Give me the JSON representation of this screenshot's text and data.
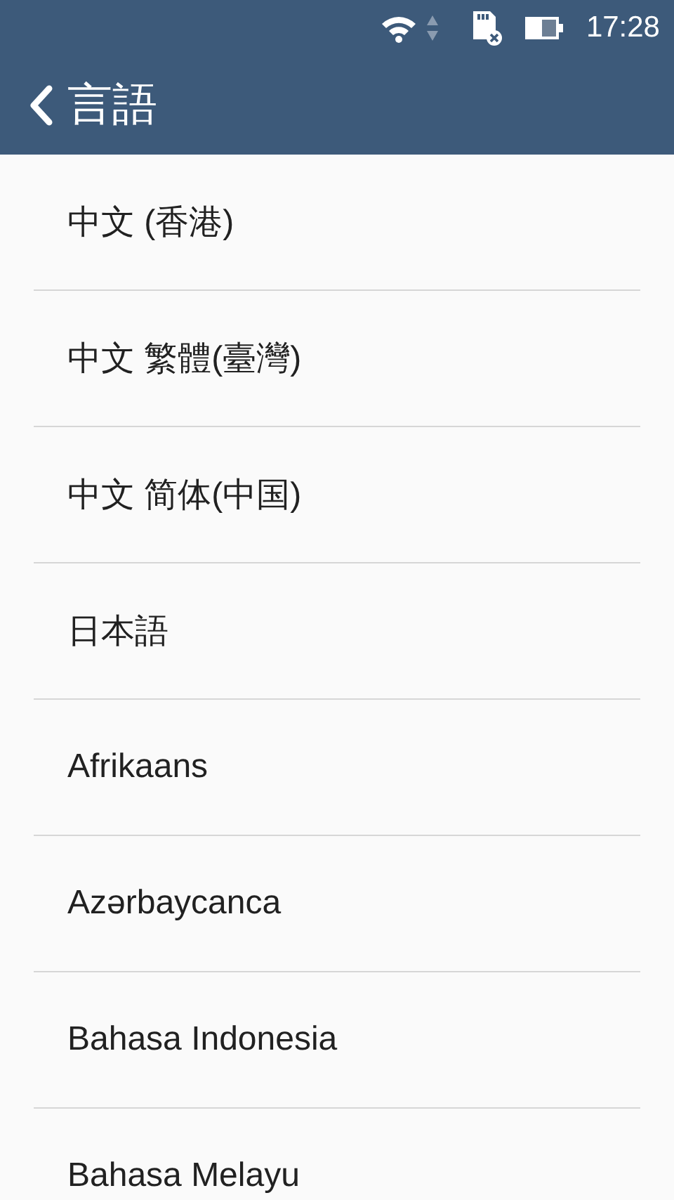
{
  "status_bar": {
    "time": "17:28"
  },
  "toolbar": {
    "title": "言語"
  },
  "languages": [
    {
      "label": "中文 (香港)"
    },
    {
      "label": "中文 繁體(臺灣)"
    },
    {
      "label": "中文 简体(中国)"
    },
    {
      "label": "日本語"
    },
    {
      "label": "Afrikaans"
    },
    {
      "label": "Azərbaycanca"
    },
    {
      "label": "Bahasa Indonesia"
    },
    {
      "label": "Bahasa Melayu"
    }
  ]
}
